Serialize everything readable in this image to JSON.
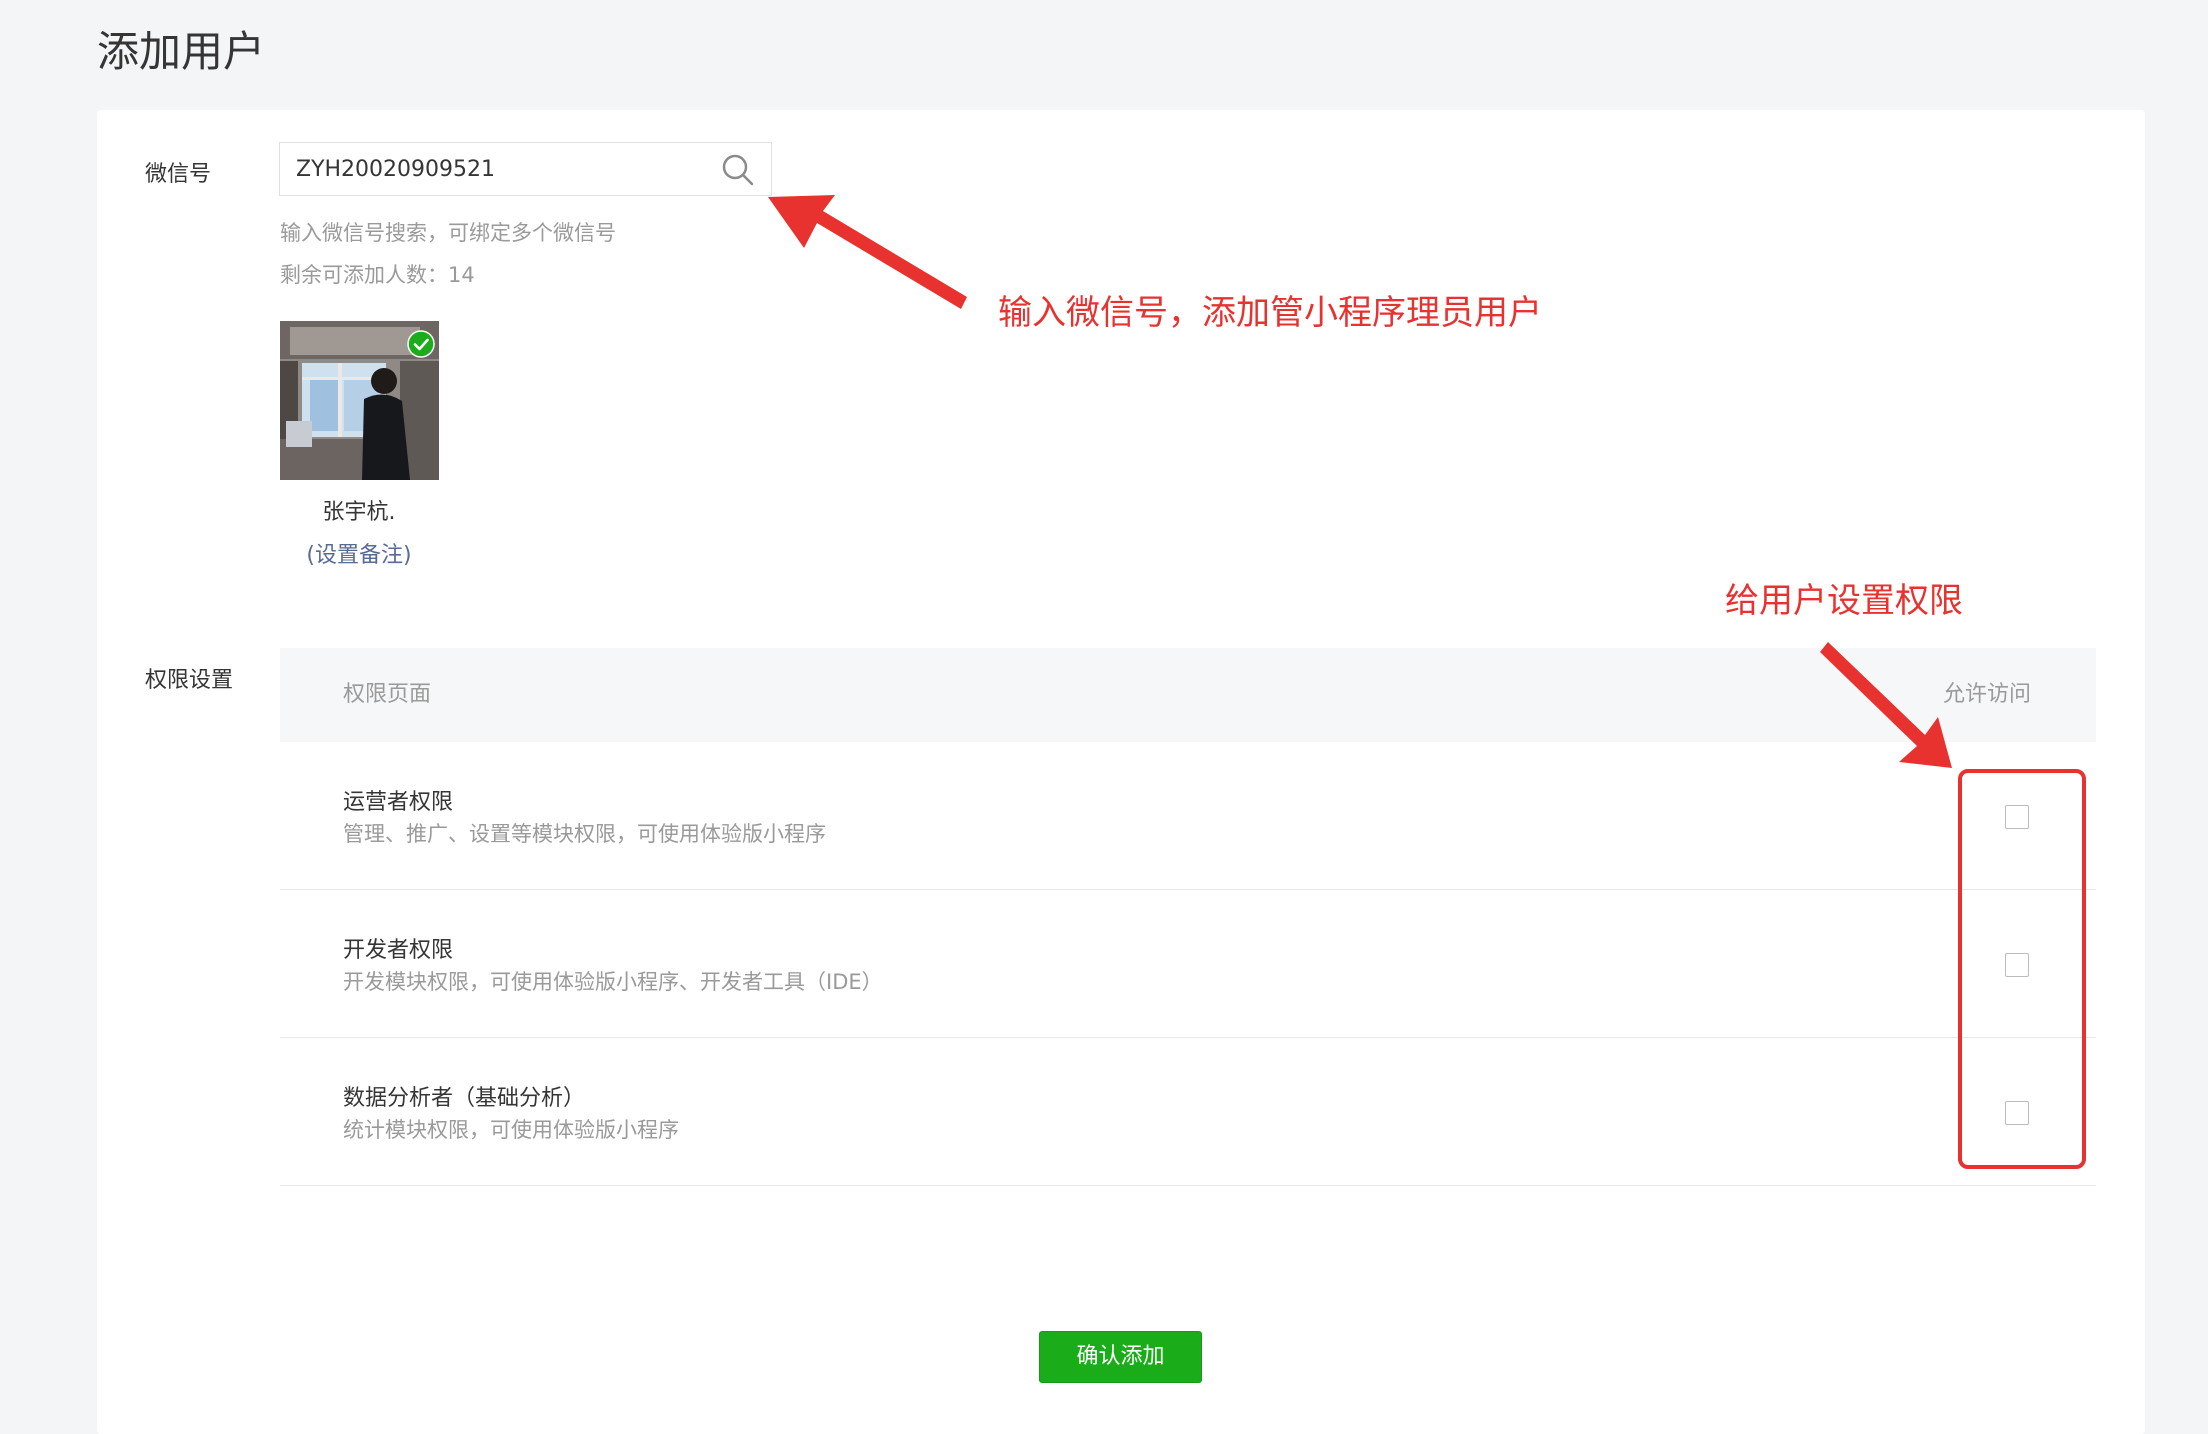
{
  "page": {
    "title": "添加用户"
  },
  "wechat": {
    "label": "微信号",
    "value": "ZYH20020909521",
    "hint": "输入微信号搜索，可绑定多个微信号",
    "remaining_label": "剩余可添加人数：14"
  },
  "user": {
    "name": "张宇杭.",
    "remark_link": "(设置备注)",
    "selected": true
  },
  "permissions": {
    "label": "权限设置",
    "header_page": "权限页面",
    "header_allow": "允许访问",
    "rows": [
      {
        "title": "运营者权限",
        "desc": "管理、推广、设置等模块权限，可使用体验版小程序",
        "checked": false
      },
      {
        "title": "开发者权限",
        "desc": "开发模块权限，可使用体验版小程序、开发者工具（IDE）",
        "checked": false
      },
      {
        "title": "数据分析者（基础分析）",
        "desc": "统计模块权限，可使用体验版小程序",
        "checked": false
      }
    ]
  },
  "actions": {
    "confirm_label": "确认添加"
  },
  "annotations": {
    "search_note": "输入微信号，添加管小程序理员用户",
    "permission_note": "给用户设置权限"
  },
  "colors": {
    "primary_green": "#1aad19",
    "link_blue": "#576b95",
    "annotation_red": "#e8322f"
  },
  "icons": {
    "search": "search-icon",
    "selected_check": "check-circle-icon",
    "arrow": "arrow-icon"
  }
}
